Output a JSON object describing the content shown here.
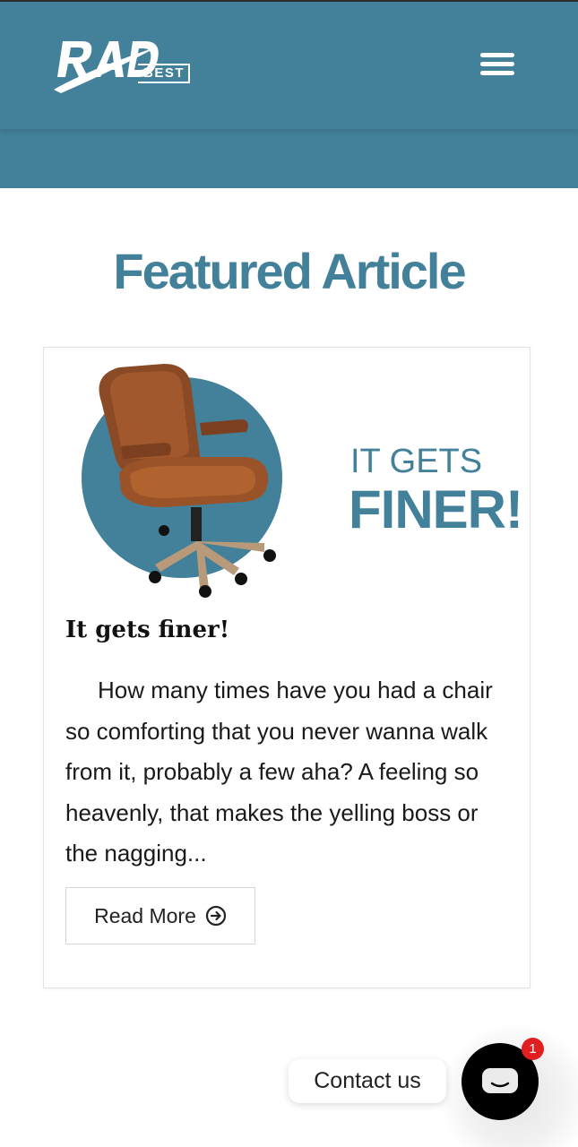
{
  "header": {
    "logo_text": "RAD",
    "logo_badge": "BEST",
    "menu_icon": "hamburger-menu-icon"
  },
  "featured": {
    "heading": "Featured Article"
  },
  "article": {
    "image_line1": "IT GETS",
    "image_line2": "FINER!",
    "title": "It gets finer!",
    "excerpt": "How many times have you had a chair so comforting that you never wanna walk from it, probably a few aha? A feeling so heavenly, that makes the yelling boss or the nagging...",
    "read_more_label": "Read More",
    "read_more_icon": "arrow-circle-right-icon"
  },
  "contact": {
    "label": "Contact us",
    "badge_count": "1",
    "icon": "chat-bubble-icon"
  },
  "colors": {
    "brand": "#43809a",
    "badge": "#e02020"
  }
}
